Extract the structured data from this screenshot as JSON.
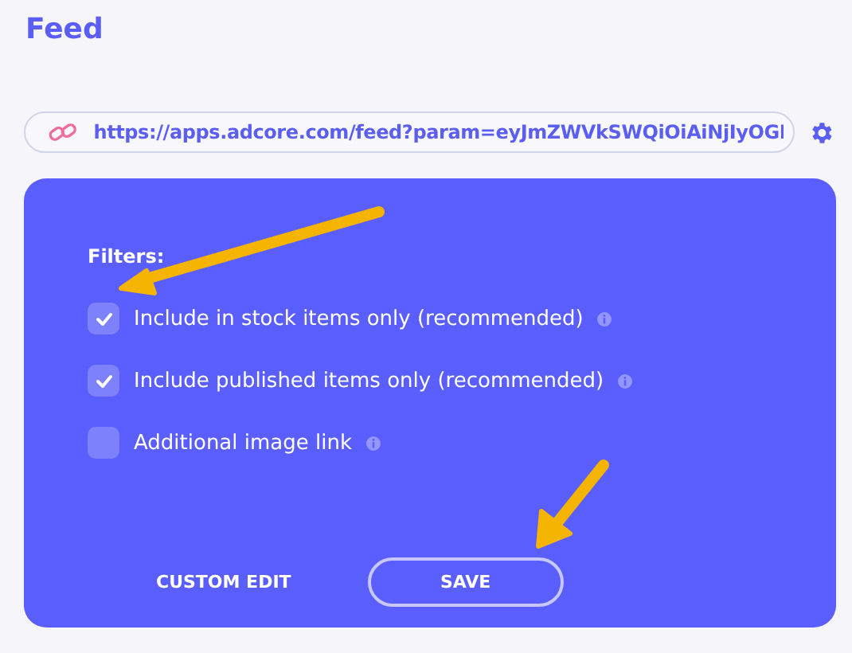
{
  "title": "Feed",
  "url_field": {
    "value": "https://apps.adcore.com/feed?param=eyJmZWVkSWQiOiAiNjIyOGI"
  },
  "filters": {
    "heading": "Filters:",
    "items": [
      {
        "label": "Include in stock items only (recommended)",
        "checked": true
      },
      {
        "label": "Include published items only (recommended)",
        "checked": true
      },
      {
        "label": "Additional image link",
        "checked": false
      }
    ]
  },
  "buttons": [
    {
      "label": "CUSTOM EDIT",
      "kind": "text"
    },
    {
      "label": "SAVE",
      "kind": "outline"
    }
  ]
}
